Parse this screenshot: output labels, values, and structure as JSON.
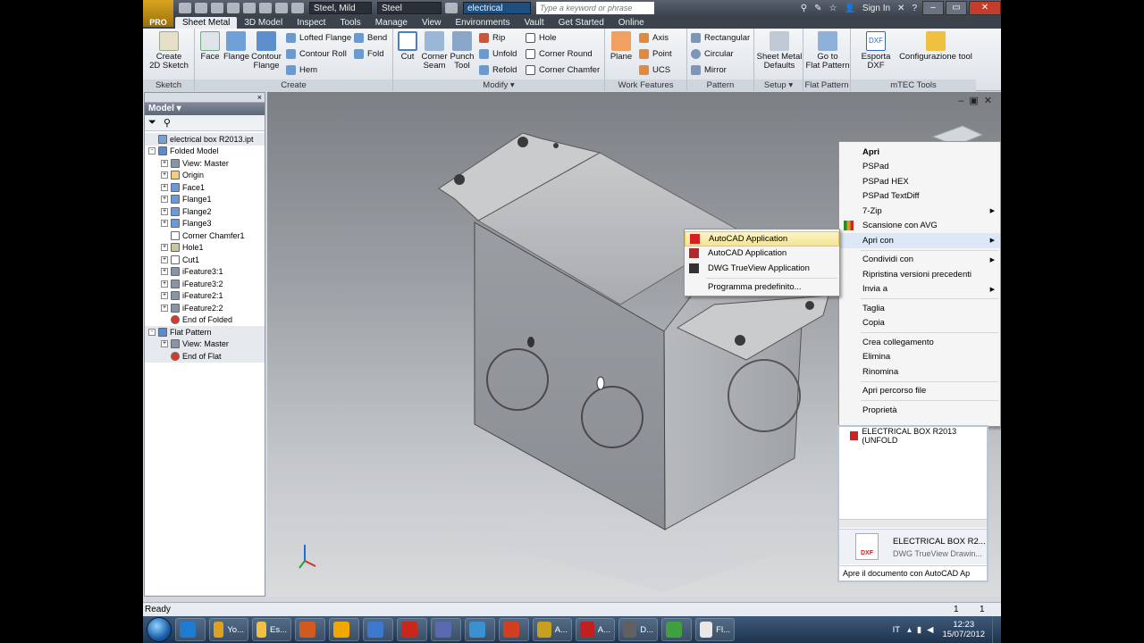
{
  "app": {
    "logo": "PRO"
  },
  "qat": {
    "material": "Steel, Mild",
    "appearance": "Steel",
    "doc_tab": "electrical",
    "search_placeholder": "Type a keyword or phrase",
    "sign_in": "Sign In"
  },
  "tabs": [
    "Sheet Metal",
    "3D Model",
    "Inspect",
    "Tools",
    "Manage",
    "View",
    "Environments",
    "Vault",
    "Get Started",
    "Online"
  ],
  "ribbon": {
    "panels": {
      "sketch": "Sketch",
      "create": "Create",
      "modify": "Modify",
      "work": "Work Features",
      "pattern": "Pattern",
      "setup": "Setup",
      "flat": "Flat Pattern",
      "mtec": "mTEC Tools"
    },
    "create_sketch": "Create\n2D Sketch",
    "face": "Face",
    "flange": "Flange",
    "contour_flange": "Contour\nFlange",
    "lofted_flange": "Lofted Flange",
    "contour_roll": "Contour Roll",
    "hem": "Hem",
    "bend": "Bend",
    "fold": "Fold",
    "cut": "Cut",
    "corner_seam": "Corner\nSeam",
    "punch_tool": "Punch\nTool",
    "rip": "Rip",
    "unfold": "Unfold",
    "refold": "Refold",
    "hole": "Hole",
    "corner_round": "Corner Round",
    "corner_chamfer": "Corner Chamfer",
    "plane": "Plane",
    "axis": "Axis",
    "point": "Point",
    "ucs": "UCS",
    "rectangular": "Rectangular",
    "circular": "Circular",
    "mirror": "Mirror",
    "sm_defaults": "Sheet Metal\nDefaults",
    "goto_flat": "Go to\nFlat Pattern",
    "esporta_dxf": "Esporta DXF",
    "config_tool": "Configurazione tool"
  },
  "browser": {
    "title": "Model",
    "tree": [
      {
        "label": "electrical box R2013.ipt",
        "depth": 0,
        "icon": "part-icon",
        "exp": ""
      },
      {
        "label": "Folded Model",
        "depth": 0,
        "icon": "folded-model-icon",
        "exp": "-"
      },
      {
        "label": "View: Master",
        "depth": 1,
        "icon": "view-icon",
        "exp": "+"
      },
      {
        "label": "Origin",
        "depth": 1,
        "icon": "folder-icon",
        "exp": "+"
      },
      {
        "label": "Face1",
        "depth": 1,
        "icon": "face-icon",
        "exp": "+"
      },
      {
        "label": "Flange1",
        "depth": 1,
        "icon": "flange-icon",
        "exp": "+"
      },
      {
        "label": "Flange2",
        "depth": 1,
        "icon": "flange-icon",
        "exp": "+"
      },
      {
        "label": "Flange3",
        "depth": 1,
        "icon": "flange-icon",
        "exp": "+"
      },
      {
        "label": "Corner Chamfer1",
        "depth": 1,
        "icon": "chamfer-icon",
        "exp": ""
      },
      {
        "label": "Hole1",
        "depth": 1,
        "icon": "hole-icon",
        "exp": "+"
      },
      {
        "label": "Cut1",
        "depth": 1,
        "icon": "cut-icon",
        "exp": "+"
      },
      {
        "label": "iFeature3:1",
        "depth": 1,
        "icon": "ifeature-icon",
        "exp": "+"
      },
      {
        "label": "iFeature3:2",
        "depth": 1,
        "icon": "ifeature-icon",
        "exp": "+"
      },
      {
        "label": "iFeature2:1",
        "depth": 1,
        "icon": "ifeature-icon",
        "exp": "+"
      },
      {
        "label": "iFeature2:2",
        "depth": 1,
        "icon": "ifeature-icon",
        "exp": "+"
      },
      {
        "label": "End of Folded",
        "depth": 1,
        "icon": "end-icon",
        "exp": ""
      },
      {
        "label": "Flat Pattern",
        "depth": 0,
        "icon": "flat-pattern-icon",
        "exp": "-"
      },
      {
        "label": "View: Master",
        "depth": 1,
        "icon": "view-icon",
        "exp": "+"
      },
      {
        "label": "End of Flat",
        "depth": 1,
        "icon": "end-icon",
        "exp": ""
      }
    ]
  },
  "submenu": {
    "items": [
      {
        "label": "AutoCAD Application",
        "icon": "autocad-icon"
      },
      {
        "label": "AutoCAD Application",
        "icon": "autocad-lt-icon"
      },
      {
        "label": "DWG TrueView Application",
        "icon": "dwg-trueview-icon"
      },
      {
        "label": "Programma predefinito...",
        "icon": ""
      }
    ]
  },
  "context_menu": {
    "items": [
      "Apri",
      "PSPad",
      "PSPad HEX",
      "PSPad TextDiff",
      "7-Zip",
      "Scansione con AVG",
      "Apri con",
      "Condividi con",
      "Ripristina versioni precedenti",
      "Invia a",
      "Taglia",
      "Copia",
      "Crea collegamento",
      "Elimina",
      "Rinomina",
      "Apri percorso file",
      "Proprietà"
    ]
  },
  "explorer": {
    "file_row": "ELECTRICAL BOX R2013 (UNFOLD",
    "file_name": "ELECTRICAL BOX R2...",
    "file_type": "DWG TrueView Drawin...",
    "file_ext": "DXF",
    "status": "Apre il documento con AutoCAD Ap"
  },
  "status": {
    "text": "Ready",
    "left_num": "1",
    "right_num": "1"
  },
  "taskbar": {
    "items": [
      {
        "label": "",
        "icon": "ie-icon",
        "color": "#1f7bd0"
      },
      {
        "label": "Yo...",
        "icon": "chrome-icon",
        "color": "#e0a020"
      },
      {
        "label": "Es...",
        "icon": "explorer-icon",
        "color": "#f0c040"
      },
      {
        "label": "",
        "icon": "media-icon",
        "color": "#d05a20"
      },
      {
        "label": "",
        "icon": "outlook-icon",
        "color": "#f0a800"
      },
      {
        "label": "",
        "icon": "network-icon",
        "color": "#3c7ad0"
      },
      {
        "label": "",
        "icon": "filezilla-icon",
        "color": "#c8281c"
      },
      {
        "label": "",
        "icon": "link-icon",
        "color": "#5a6ab0"
      },
      {
        "label": "",
        "icon": "update-icon",
        "color": "#3a90d0"
      },
      {
        "label": "",
        "icon": "audio-icon",
        "color": "#d04020"
      },
      {
        "label": "A...",
        "icon": "inventor-icon",
        "color": "#c8a020"
      },
      {
        "label": "A...",
        "icon": "autocad-task-icon",
        "color": "#c02020"
      },
      {
        "label": "D...",
        "icon": "dwg-task-icon",
        "color": "#606060"
      },
      {
        "label": "",
        "icon": "dwg-tool-icon",
        "color": "#40a040"
      },
      {
        "label": "Fl...",
        "icon": "folder-task-icon",
        "color": "#e8e8e8"
      }
    ],
    "lang": "IT",
    "time": "12:23",
    "date": "15/07/2012"
  }
}
